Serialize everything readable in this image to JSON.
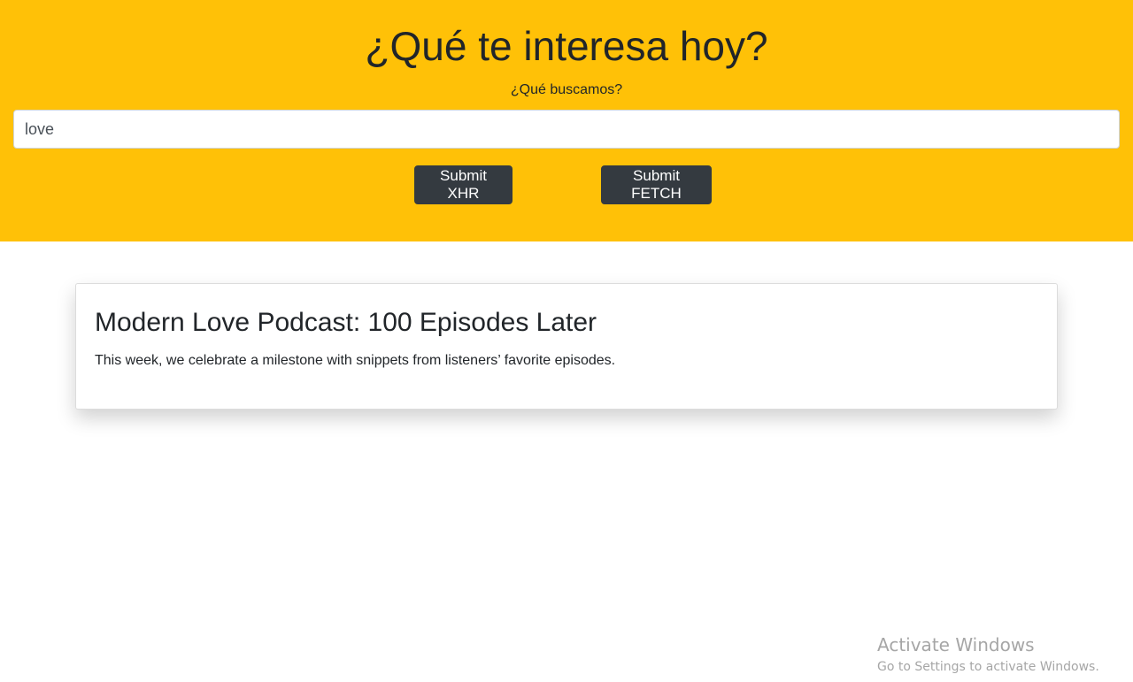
{
  "header": {
    "title": "¿Qué te interesa hoy?",
    "search_label": "¿Qué buscamos?",
    "search_value": "love",
    "buttons": {
      "xhr_label": "Submit XHR",
      "fetch_label": "Submit FETCH"
    },
    "background_color": "#ffc107"
  },
  "results": [
    {
      "title": "Modern Love Podcast: 100 Episodes Later",
      "abstract": "This week, we celebrate a milestone with snippets from listeners’ favorite episodes."
    }
  ],
  "watermark": {
    "title": "Activate Windows",
    "subtitle": "Go to Settings to activate Windows."
  }
}
